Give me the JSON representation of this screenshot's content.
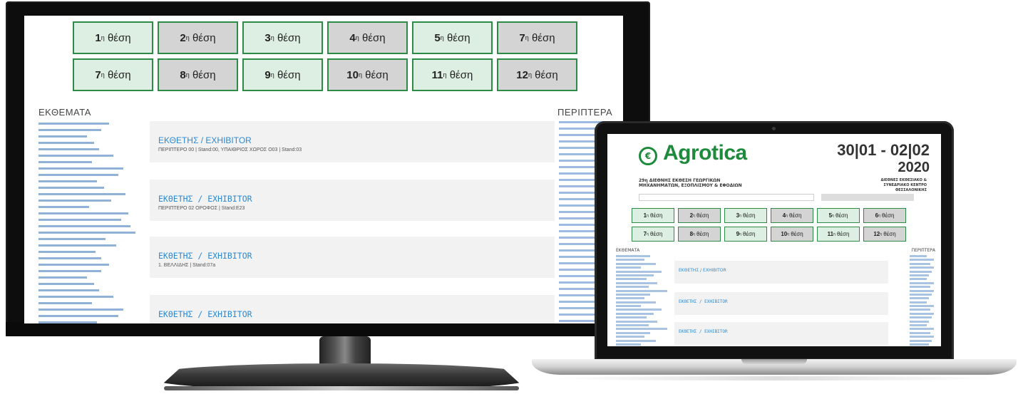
{
  "stands": [
    {
      "num": "1",
      "sup": "η",
      "label": "θέση",
      "style": "green"
    },
    {
      "num": "2",
      "sup": "η",
      "label": "θέση",
      "style": "grey"
    },
    {
      "num": "3",
      "sup": "η",
      "label": "θέση",
      "style": "green"
    },
    {
      "num": "4",
      "sup": "η",
      "label": "θέση",
      "style": "grey"
    },
    {
      "num": "5",
      "sup": "η",
      "label": "θέση",
      "style": "green"
    },
    {
      "num": "7",
      "sup": "η",
      "label": "θέση",
      "style": "grey"
    },
    {
      "num": "7",
      "sup": "η",
      "label": "θέση",
      "style": "green"
    },
    {
      "num": "8",
      "sup": "η",
      "label": "θέση",
      "style": "grey"
    },
    {
      "num": "9",
      "sup": "η",
      "label": "θέση",
      "style": "green"
    },
    {
      "num": "10",
      "sup": "η",
      "label": "θέση",
      "style": "grey"
    },
    {
      "num": "11",
      "sup": "η",
      "label": "θέση",
      "style": "green"
    },
    {
      "num": "12",
      "sup": "η",
      "label": "θέση",
      "style": "grey"
    }
  ],
  "laptop_stands": [
    {
      "num": "1",
      "sup": "η",
      "label": "θέση",
      "style": "green"
    },
    {
      "num": "2",
      "sup": "η",
      "label": "θέση",
      "style": "grey"
    },
    {
      "num": "3",
      "sup": "η",
      "label": "θέση",
      "style": "green"
    },
    {
      "num": "4",
      "sup": "η",
      "label": "θέση",
      "style": "grey"
    },
    {
      "num": "5",
      "sup": "η",
      "label": "θέση",
      "style": "green"
    },
    {
      "num": "6",
      "sup": "η",
      "label": "θέση",
      "style": "grey"
    },
    {
      "num": "7",
      "sup": "η",
      "label": "θέση",
      "style": "green"
    },
    {
      "num": "8",
      "sup": "η",
      "label": "θέση",
      "style": "grey"
    },
    {
      "num": "9",
      "sup": "η",
      "label": "θέση",
      "style": "green"
    },
    {
      "num": "10",
      "sup": "η",
      "label": "θέση",
      "style": "grey"
    },
    {
      "num": "11",
      "sup": "η",
      "label": "θέση",
      "style": "green"
    },
    {
      "num": "12",
      "sup": "η",
      "label": "θέση",
      "style": "grey"
    }
  ],
  "sections": {
    "exhibits": "ΕΚΘΕΜΑΤΑ",
    "stands": "ΠΕΡΙΠΤΕΡΑ"
  },
  "exhibitors": [
    {
      "title": "ΕΚΘΕΤΗΣ / EXHIBITOR",
      "sub": "ΠΕΡΙΠΤΕΡΟ 00 | Stand:00, ΥΠΑΙΘΡΙΟΣ ΧΩΡΟΣ Ο03 | Stand:03",
      "mono": false
    },
    {
      "title": "ΕΚΘΕΤΗΣ / EXHIBITOR",
      "sub": "ΠΕΡΙΠΤΕΡΟ 02 ΟΡΟΦΟΣ | Stand:E23",
      "mono": true
    },
    {
      "title": "ΕΚΘΕΤΗΣ / EXHIBITOR",
      "sub": "1. ΒΕΛΛΙΔΗΣ | Stand:07a",
      "mono": true
    },
    {
      "title": "ΕΚΘΕΤΗΣ / EXHIBITOR",
      "sub": "",
      "mono": true
    }
  ],
  "laptop": {
    "logo": "Agrotica",
    "date_line1": "30|01 - 02|02",
    "date_line2": "2020",
    "tagline_left": "29η ΔΙΕΘΝΗΣ ΕΚΘΕΣΗ ΓΕΩΡΓΙΚΩΝ ΜΗΧΑΝΗΜΑΤΩΝ, ΕΞΟΠΛΙΣΜΟΥ & ΕΦΟΔΙΩΝ",
    "tagline_right": "ΔΙΕΘΝΕΣ ΕΚΘΕΣΙΑΚΟ & ΣΥΝΕΔΡΙΑΚΟ ΚΕΝΤΡΟ ΘΕΣΣΑΛΟΝΙΚΗΣ"
  }
}
